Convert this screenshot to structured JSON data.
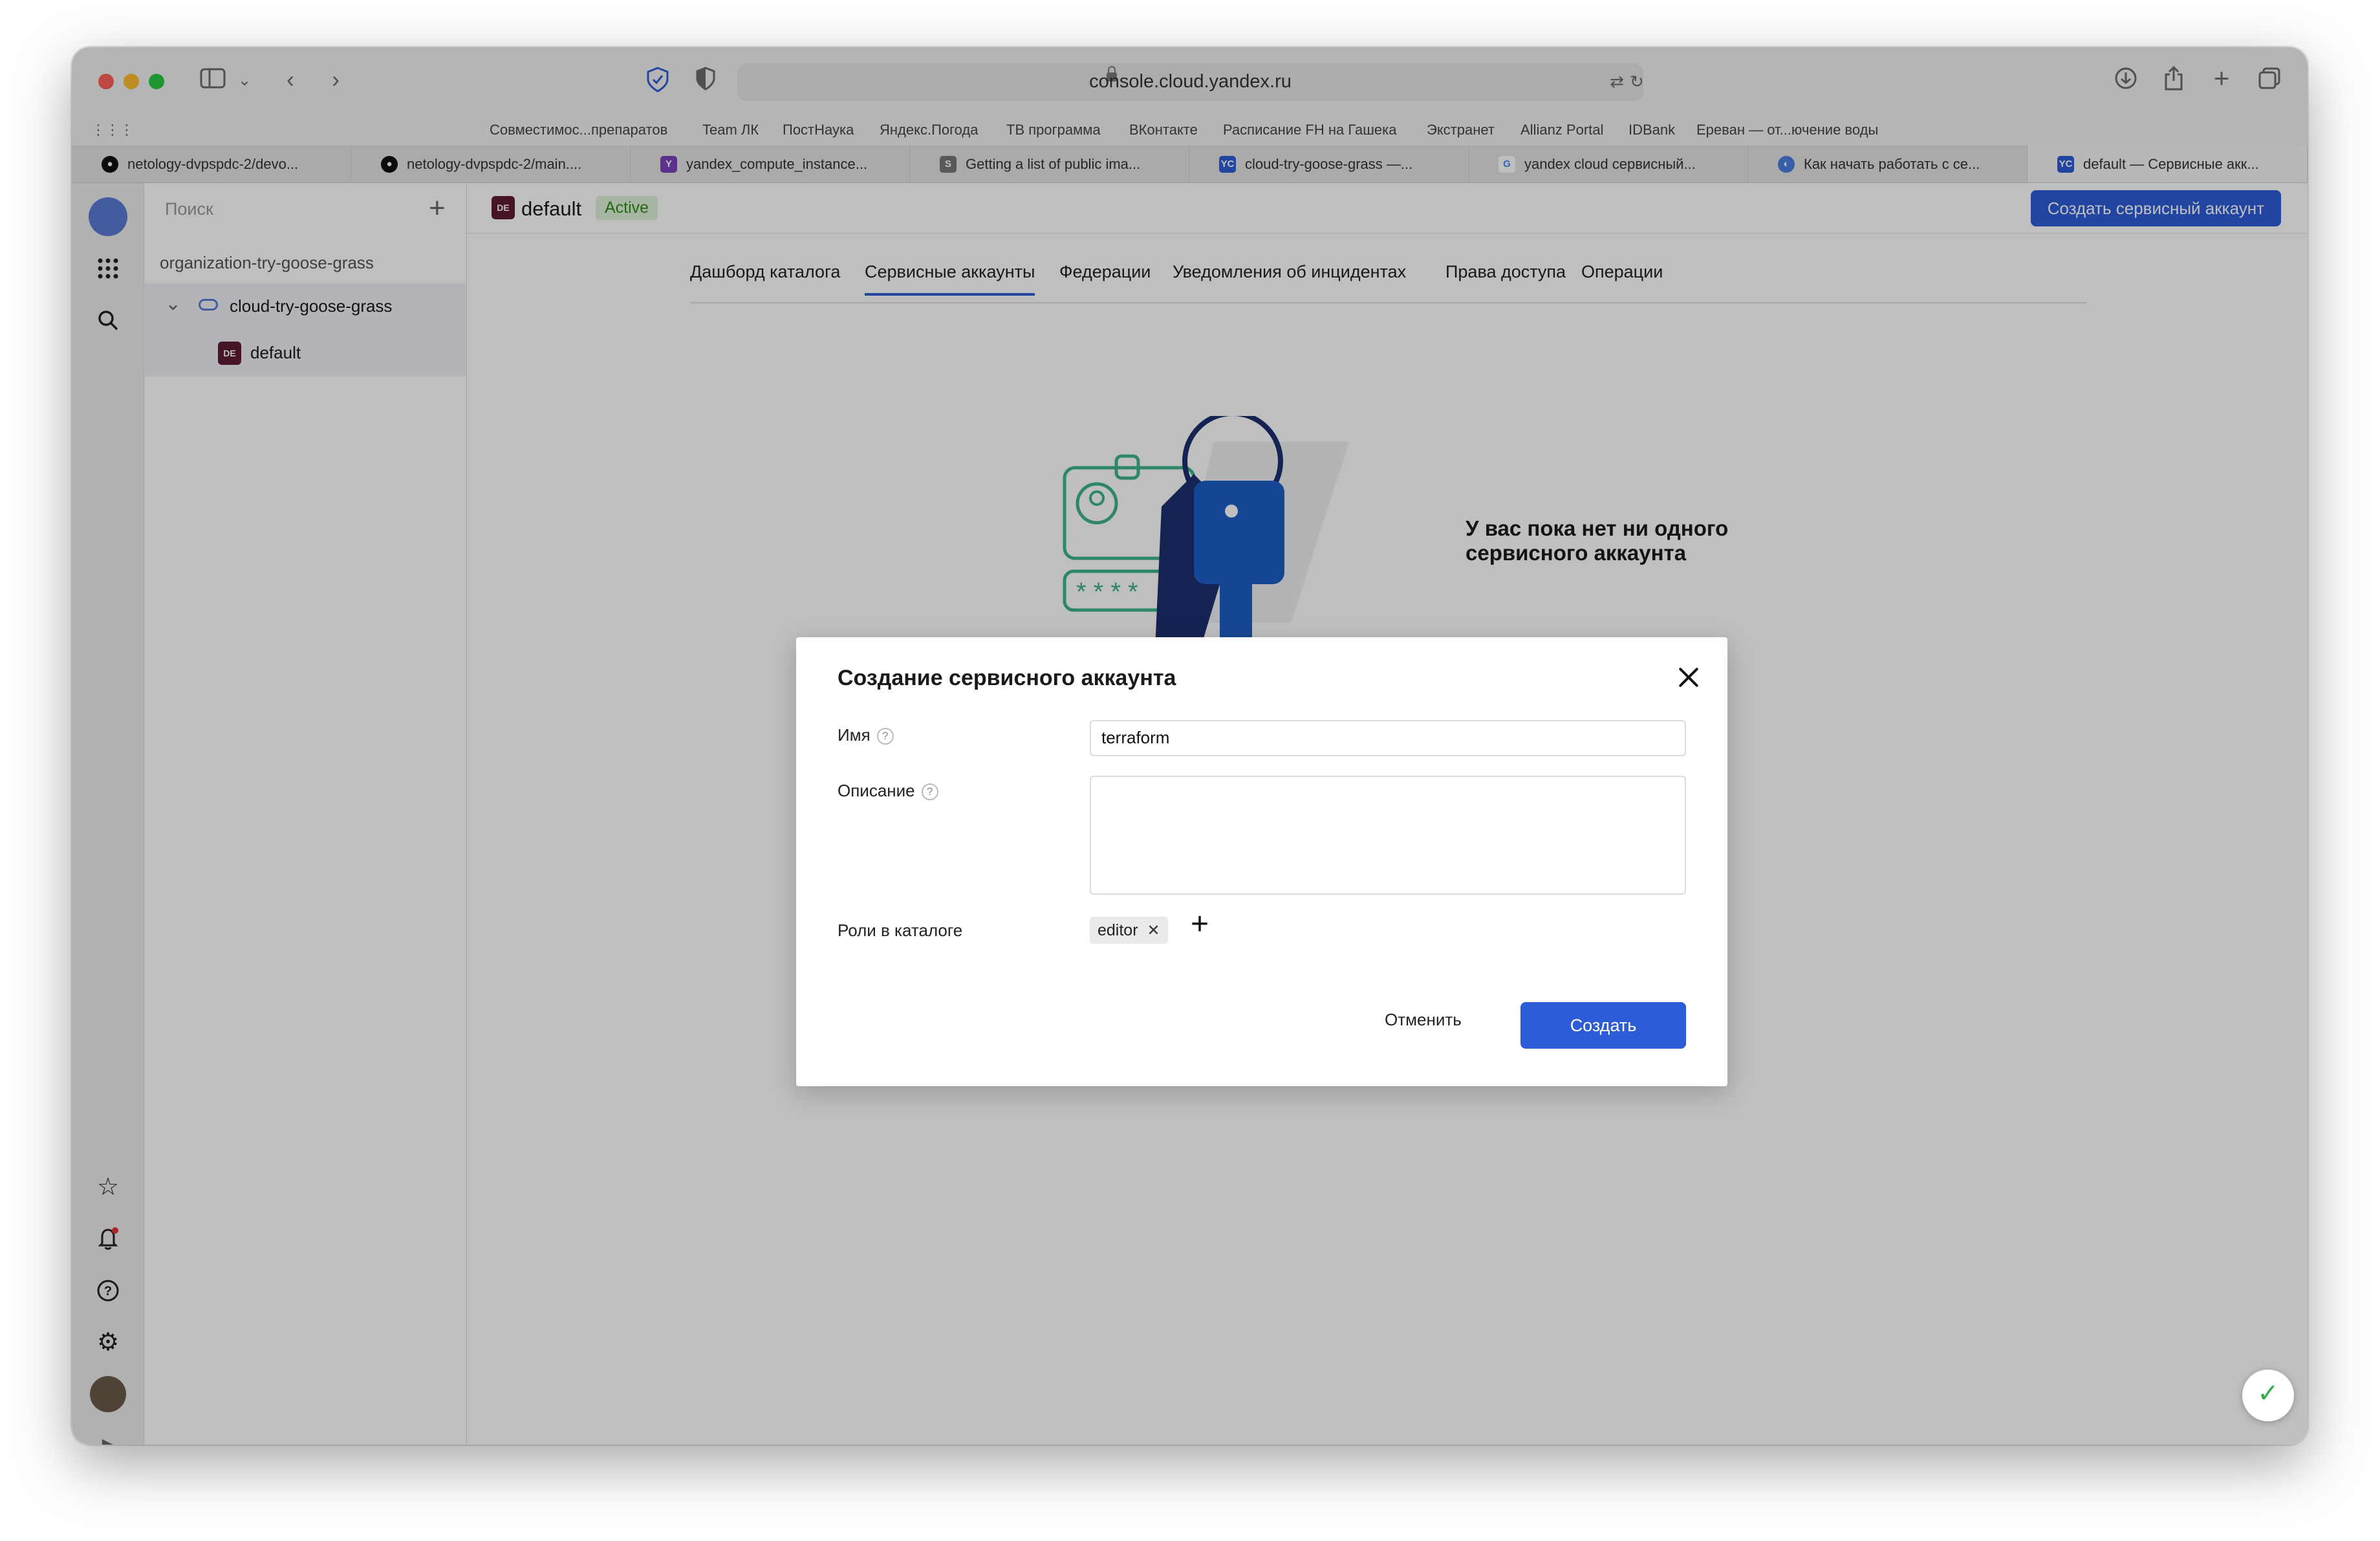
{
  "browser": {
    "url": "console.cloud.yandex.ru",
    "favorites": [
      "Совместимос...препаратов",
      "Team ЛК",
      "ПостНаука",
      "Яндекс.Погода",
      "ТВ программа",
      "ВКонтакте",
      "Расписание FH на Гашека",
      "Экстранет",
      "Allianz Portal",
      "IDBank",
      "Ереван — от...ючение воды"
    ],
    "tabs": [
      {
        "label": "netology-dvpspdc-2/devo...",
        "icon": "github-icon"
      },
      {
        "label": "netology-dvpspdc-2/main....",
        "icon": "github-icon"
      },
      {
        "label": "yandex_compute_instance...",
        "icon": "terraform-icon"
      },
      {
        "label": "Getting a list of public ima...",
        "icon": "s-icon"
      },
      {
        "label": "cloud-try-goose-grass —...",
        "icon": "yc-icon"
      },
      {
        "label": "yandex cloud сервисный...",
        "icon": "google-icon"
      },
      {
        "label": "Как начать работать с се...",
        "icon": "safari-icon"
      },
      {
        "label": "default — Сервисные акк...",
        "icon": "yc-icon"
      }
    ]
  },
  "sidebar": {
    "search_placeholder": "Поиск",
    "organization": "organization-try-goose-grass",
    "cloud": "cloud-try-goose-grass",
    "folder_badge": "DE",
    "folder": "default"
  },
  "header": {
    "badge": "DE",
    "name": "default",
    "status": "Active",
    "create_button": "Создать сервисный аккаунт"
  },
  "nav_tabs": [
    "Дашборд каталога",
    "Сервисные аккаунты",
    "Федерации",
    "Уведомления об инцидентах",
    "Права доступа",
    "Операции"
  ],
  "active_tab": "Сервисные аккаунты",
  "empty_state": {
    "title": "У вас пока нет ни одного сервисного аккаунта"
  },
  "dialog": {
    "title": "Создание сервисного аккаунта",
    "name_label": "Имя",
    "name_value": "terraform",
    "description_label": "Описание",
    "description_value": "",
    "roles_label": "Роли в каталоге",
    "role_chip": "editor",
    "cancel": "Отменить",
    "create": "Создать"
  },
  "colors": {
    "accent": "#2c5dd6",
    "active_status_bg": "#dff3d9",
    "folder_badge": "#5d1d34"
  }
}
